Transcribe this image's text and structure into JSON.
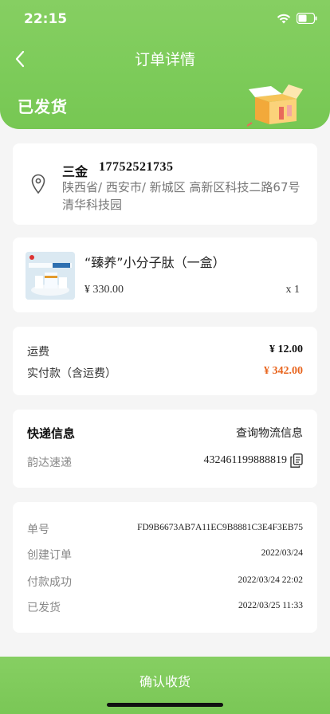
{
  "status_bar": {
    "time": "22:15"
  },
  "nav": {
    "title": "订单详情"
  },
  "order_status": {
    "title": "已发货"
  },
  "address": {
    "name": "三金",
    "phone": "17752521735",
    "text": "陕西省/ 西安市/ 新城区 高新区科技二路67号清华科技园"
  },
  "product": {
    "name": "“臻养”小分子肽（一盒）",
    "price": "¥ 330.00",
    "qty": "x 1",
    "image_label_1": "美好生活",
    "image_label_2": "臻养相伴"
  },
  "fees": {
    "freight_label": "运费",
    "freight_value": "¥ 12.00",
    "paid_label": "实付款（含运费）",
    "paid_value": "¥ 342.00",
    "paid_color": "#e8651e"
  },
  "express": {
    "title": "快递信息",
    "link": "查询物流信息",
    "company": "韵达速递",
    "number": "432461199888819"
  },
  "order_info": {
    "rows": [
      {
        "label": "单号",
        "value": "FD9B6673AB7A11EC9B8881C3E4F3EB75"
      },
      {
        "label": "创建订单",
        "value": "2022/03/24"
      },
      {
        "label": "付款成功",
        "value": "2022/03/24 22:02"
      },
      {
        "label": "已发货",
        "value": "2022/03/25 11:33"
      }
    ]
  },
  "actions": {
    "confirm_label": "确认收货"
  },
  "colors": {
    "brand_green": "#7ccb59",
    "accent_orange": "#e8651e"
  }
}
